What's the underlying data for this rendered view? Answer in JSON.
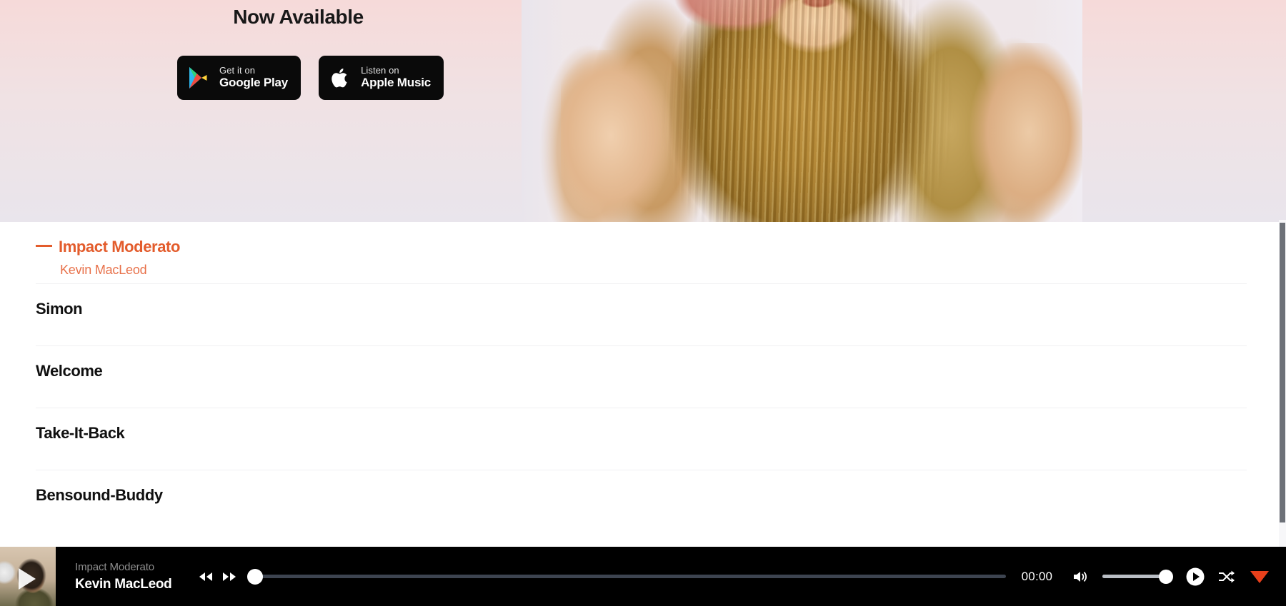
{
  "hero": {
    "heading": "Now Available",
    "store_buttons": [
      {
        "icon": "google-play-icon",
        "small": "Get it on",
        "big": "Google Play"
      },
      {
        "icon": "apple-icon",
        "small": "Listen on",
        "big": "Apple Music"
      }
    ],
    "photo_alt": "woman-with-long-hair-photo"
  },
  "tracklist": [
    {
      "title": "Impact Moderato",
      "artist": "Kevin MacLeod",
      "active": true
    },
    {
      "title": "Simon",
      "artist": "",
      "active": false
    },
    {
      "title": "Welcome",
      "artist": "",
      "active": false
    },
    {
      "title": "Take-It-Back",
      "artist": "",
      "active": false
    },
    {
      "title": "Bensound-Buddy",
      "artist": "",
      "active": false
    }
  ],
  "player": {
    "now_playing_title": "Impact Moderato",
    "now_playing_artist": "Kevin MacLeod",
    "current_time": "00:00",
    "progress_percent": 0,
    "volume_percent": 85,
    "controls": {
      "rewind": "rewind-icon",
      "forward": "fast-forward-icon",
      "volume": "volume-icon",
      "play": "play-circle-icon",
      "shuffle": "shuffle-icon",
      "collapse": "collapse-triangle-icon",
      "thumb_play": "play-overlay-icon"
    }
  },
  "colors": {
    "accent": "#e35c2c",
    "accent_light": "#e8714a",
    "player_bg": "#000000",
    "collapse_triangle": "#e8401b"
  }
}
